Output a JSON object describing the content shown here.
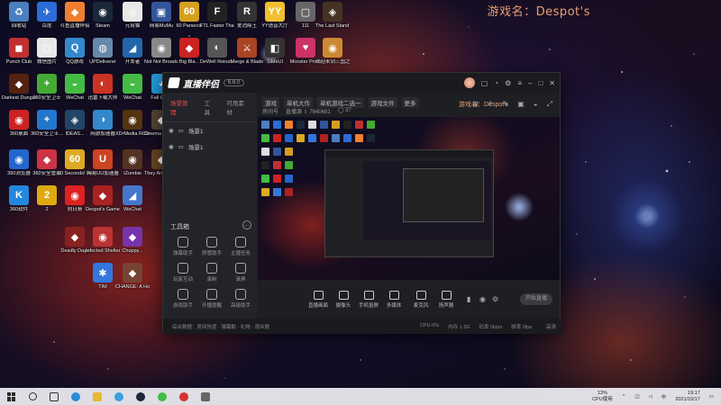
{
  "watermark": "游戏名：Despot's",
  "desktop_icons": [
    {
      "name": "回收站",
      "color": "#4a7fc0",
      "glyph": "♻"
    },
    {
      "name": "百度",
      "color": "#2b6cd6",
      "glyph": "✈"
    },
    {
      "name": "斗鱼直播伴侣",
      "color": "#f08030",
      "glyph": "◆"
    },
    {
      "name": "Steam",
      "color": "#1b2838",
      "glyph": "◉"
    },
    {
      "name": "元宵猫",
      "color": "#e8e8e8",
      "glyph": "◎"
    },
    {
      "name": "网易MuMu",
      "color": "#335599",
      "glyph": "▣"
    },
    {
      "name": "60 Parsecs!",
      "color": "#d4a020",
      "glyph": "60"
    },
    {
      "name": "FTL Faster Than Light",
      "color": "#222",
      "glyph": "F"
    },
    {
      "name": "爱消除王",
      "color": "#333",
      "glyph": "R"
    },
    {
      "name": "YY语音大厅",
      "color": "#f0c030",
      "glyph": "YY"
    },
    {
      "name": "111",
      "color": "#666",
      "glyph": "▢"
    },
    {
      "name": "The Last Stand A...",
      "color": "#443322",
      "glyph": "◈"
    },
    {
      "name": "Punch Club",
      "color": "#c03030",
      "glyph": "◼"
    },
    {
      "name": "微信图片",
      "color": "#e8e8e8",
      "glyph": "◻"
    },
    {
      "name": "QQ游戏",
      "color": "#3388cc",
      "glyph": "Q"
    },
    {
      "name": "UPDeliverer",
      "color": "#6688aa",
      "glyph": "◍"
    },
    {
      "name": "开发者",
      "color": "#2266aa",
      "glyph": "◢"
    },
    {
      "name": "Not Not Broadcast",
      "color": "#888",
      "glyph": "◉"
    },
    {
      "name": "Big Bla...",
      "color": "#cc2222",
      "glyph": "◆"
    },
    {
      "name": "DeWell Reinst...",
      "color": "#555",
      "glyph": "◐"
    },
    {
      "name": "Merge & Blade",
      "color": "#aa4422",
      "glyph": "⚔"
    },
    {
      "name": "SiMeUI",
      "color": "#333",
      "glyph": "◧"
    },
    {
      "name": "Monster Prom",
      "color": "#cc3366",
      "glyph": "♥"
    },
    {
      "name": "欢迎来到三国之...",
      "color": "#cc8833",
      "glyph": "◉"
    },
    {
      "name": "Darkest Dungeon",
      "color": "#552211",
      "glyph": "◆"
    },
    {
      "name": "360安全卫士",
      "color": "#44aa33",
      "glyph": "+"
    },
    {
      "name": "WeChat",
      "color": "#44bb44",
      "glyph": "◒"
    },
    {
      "name": "迅雷下载大师",
      "color": "#cc3322",
      "glyph": "◐"
    },
    {
      "name": "WeChat",
      "color": "#44bb44",
      "glyph": "◒"
    },
    {
      "name": "Fall Guys",
      "color": "#2299dd",
      "glyph": "◕"
    },
    {
      "name": "360桌面",
      "color": "#cc2222",
      "glyph": "◉"
    },
    {
      "name": "360安全卫士...",
      "color": "#2277cc",
      "glyph": "+"
    },
    {
      "name": "IDEAS...",
      "color": "#224466",
      "glyph": "◈"
    },
    {
      "name": "网游加速器",
      "color": "#3388cc",
      "glyph": "◑"
    },
    {
      "name": "XDrMedia RClientral 4",
      "color": "#553311",
      "glyph": "◉"
    },
    {
      "name": "Cinema Empire",
      "color": "#554433",
      "glyph": "◆"
    },
    {
      "name": "360浏览器",
      "color": "#2266cc",
      "glyph": "◉"
    },
    {
      "name": "360安全管家",
      "color": "#cc3344",
      "glyph": "◆"
    },
    {
      "name": "60 Seconds! Reatomized",
      "color": "#ddaa22",
      "glyph": "60"
    },
    {
      "name": "网易UU加速器",
      "color": "#cc4422",
      "glyph": "U"
    },
    {
      "name": "IZombie",
      "color": "#553322",
      "glyph": "◉"
    },
    {
      "name": "They Are Billions",
      "color": "#664422",
      "glyph": "◆"
    },
    {
      "name": "360软件",
      "color": "#2288dd",
      "glyph": "K"
    },
    {
      "name": "2",
      "color": "#ddaa11",
      "glyph": "2"
    },
    {
      "name": "向日葵",
      "color": "#dd2222",
      "glyph": "◉"
    },
    {
      "name": "Despot's Game",
      "color": "#aa2222",
      "glyph": "◆"
    },
    {
      "name": "WeChat",
      "color": "#4477cc",
      "glyph": "◢"
    },
    {
      "name": "Deadly Days",
      "color": "#882222",
      "glyph": "◆"
    },
    {
      "name": "Infected Shelter",
      "color": "#bb3333",
      "glyph": "◉"
    },
    {
      "name": "Choppy...",
      "color": "#7733aa",
      "glyph": "◆"
    },
    {
      "name": "TIM",
      "color": "#3377dd",
      "glyph": "✱"
    },
    {
      "name": "CHANGE: A Homeles...",
      "color": "#774433",
      "glyph": "◆"
    }
  ],
  "app": {
    "name": "直播伴侣",
    "version": "6.6.0",
    "tabs": [
      "场景管理",
      "工具",
      "可用素材"
    ],
    "scenes": [
      {
        "label": "场景1"
      },
      {
        "label": "场景1"
      }
    ],
    "tools_title": "工具箱",
    "tools": [
      "弹幕助手",
      "房管助手",
      "主播任务",
      "玩家互动",
      "录制",
      "录屏",
      "游戏助手",
      "开播提醒",
      "高级助手"
    ],
    "breadcrumb": [
      "游戏",
      "单机大作",
      "单机游戏二选一",
      "游戏文件",
      "更多"
    ],
    "room_info": [
      "房间号",
      "直播源 ⇧ 7640691",
      "◯ 37"
    ],
    "preview_title": "游戏名：Despot's",
    "controls": [
      "直播画面",
      "摄像头",
      "手机投屏",
      "多媒体",
      "麦克风",
      "扬声器"
    ],
    "live_button": "开始直播",
    "status_text": "综合数据：房间热度 · 弹幕数 · 礼物 · 观众数",
    "stats": [
      "CPU 0%",
      "内存 1.2G",
      "码率 0kb/s",
      "帧率 0fps"
    ],
    "mode": "高清"
  },
  "taskbar": {
    "cpu_label": "CPU使用",
    "cpu_value": "13%",
    "time": "19:17",
    "date": "2021/10/17"
  }
}
